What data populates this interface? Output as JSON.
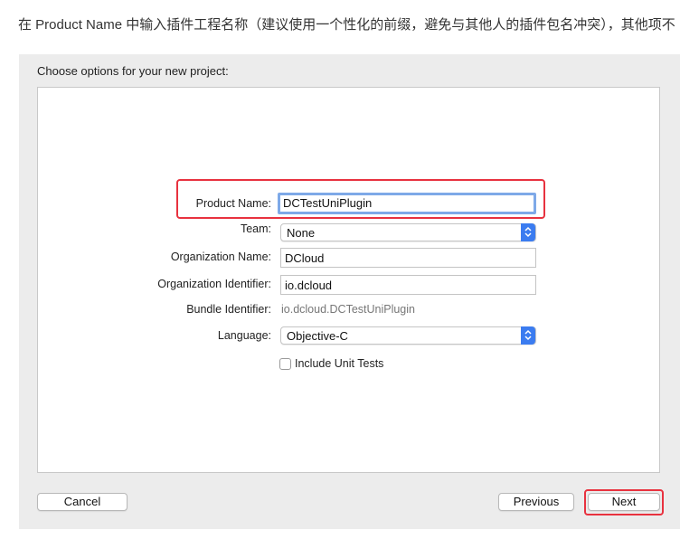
{
  "caption": "在 Product Name 中输入插件工程名称（建议使用一个性化的前缀，避免与其他人的插件包名冲突），其他项不",
  "dialog": {
    "title": "Choose options for your new project:",
    "form": {
      "product_name_label": "Product Name:",
      "product_name_value": "DCTestUniPlugin",
      "team_label": "Team:",
      "team_value": "None",
      "org_name_label": "Organization Name:",
      "org_name_value": "DCloud",
      "org_id_label": "Organization Identifier:",
      "org_id_value": "io.dcloud",
      "bundle_id_label": "Bundle Identifier:",
      "bundle_id_value": "io.dcloud.DCTestUniPlugin",
      "language_label": "Language:",
      "language_value": "Objective-C",
      "include_unit_tests_label": "Include Unit Tests",
      "include_unit_tests_checked": false
    },
    "buttons": {
      "cancel": "Cancel",
      "previous": "Previous",
      "next": "Next"
    }
  },
  "colors": {
    "highlight": "#e8323f",
    "accent": "#3b7cf0",
    "focus_ring": "#7ea9e8"
  }
}
